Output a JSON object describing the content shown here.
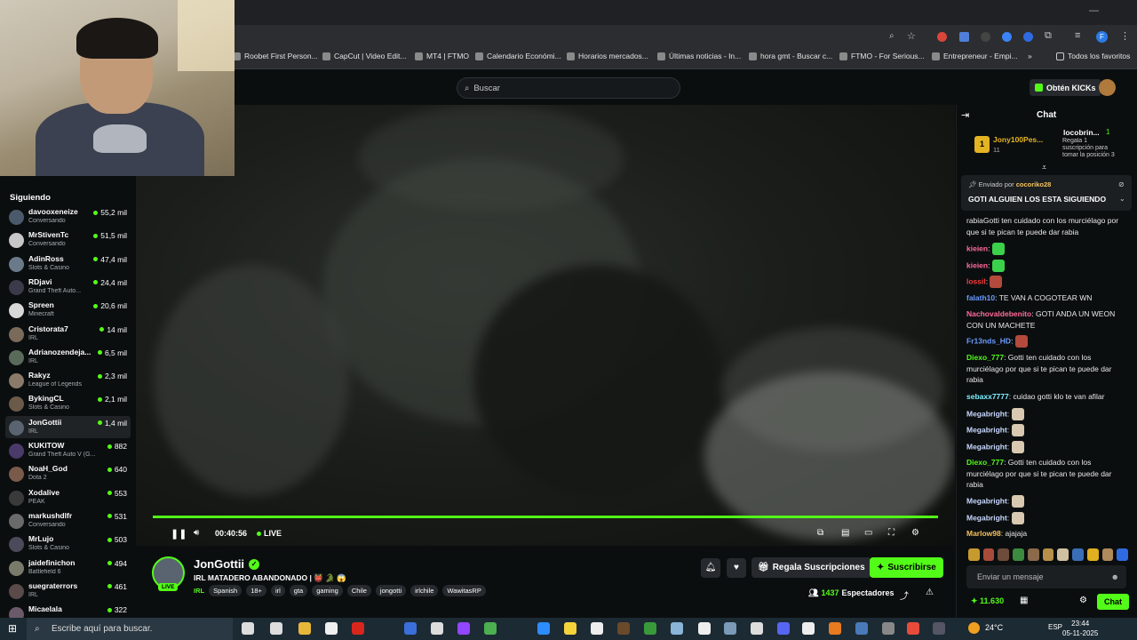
{
  "browser": {
    "bookmarks": [
      {
        "label": "Roobet First Person..."
      },
      {
        "label": "CapCut | Video Edit..."
      },
      {
        "label": "MT4 | FTMO"
      },
      {
        "label": "Calendario Económi..."
      },
      {
        "label": "Horarios mercados..."
      },
      {
        "label": "Últimas noticias - In..."
      },
      {
        "label": "hora gmt - Buscar c..."
      },
      {
        "label": "FTMO - For Serious..."
      },
      {
        "label": "Entrepreneur - Empi..."
      }
    ],
    "more": "»",
    "all_favorites": "Todos los favoritos"
  },
  "header": {
    "search_placeholder": "Buscar",
    "kicks_label": "Obtén KICKs"
  },
  "sidebar": {
    "title": "Siguiendo",
    "channels": [
      {
        "name": "davooxeneize",
        "category": "Conversando",
        "viewers": "55,2 mil"
      },
      {
        "name": "MrStivenTc",
        "category": "Conversando",
        "viewers": "51,5 mil"
      },
      {
        "name": "AdinRoss",
        "category": "Slots & Casino",
        "viewers": "47,4 mil"
      },
      {
        "name": "RDjavi",
        "category": "Grand Theft Auto...",
        "viewers": "24,4 mil"
      },
      {
        "name": "Spreen",
        "category": "Minecraft",
        "viewers": "20,6 mil"
      },
      {
        "name": "Cristorata7",
        "category": "IRL",
        "viewers": "14 mil"
      },
      {
        "name": "Adrianozendeja...",
        "category": "IRL",
        "viewers": "6,5 mil"
      },
      {
        "name": "Rakyz",
        "category": "League of Legends",
        "viewers": "2,3 mil"
      },
      {
        "name": "BykingCL",
        "category": "Slots & Casino",
        "viewers": "2,1 mil"
      },
      {
        "name": "JonGottii",
        "category": "IRL",
        "viewers": "1,4 mil"
      },
      {
        "name": "KUKITOW",
        "category": "Grand Theft Auto V (G...",
        "viewers": "882"
      },
      {
        "name": "NoaH_God",
        "category": "Dota 2",
        "viewers": "640"
      },
      {
        "name": "Xodalive",
        "category": "PEAK",
        "viewers": "553"
      },
      {
        "name": "markushdlfr",
        "category": "Conversando",
        "viewers": "531"
      },
      {
        "name": "MrLujo",
        "category": "Slots & Casino",
        "viewers": "503"
      },
      {
        "name": "jaidefinichon",
        "category": "Battlefield 6",
        "viewers": "494"
      },
      {
        "name": "suegraterrors",
        "category": "IRL",
        "viewers": "461"
      },
      {
        "name": "Micaelala",
        "category": "",
        "viewers": "322"
      }
    ]
  },
  "player": {
    "time": "00:40:56",
    "live": "LIVE",
    "progress": 1.0
  },
  "stream": {
    "name": "JonGottii",
    "live_badge": "LIVE",
    "title": "IRL MATADERO ABANDONADO | 👹 🐊 😱",
    "category": "IRL",
    "tags": [
      "Spanish",
      "18+",
      "irl",
      "gta",
      "gaming",
      "Chile",
      "jongotti",
      "irlchile",
      "WawitasRP"
    ],
    "gift_label": "Regala Suscripciones",
    "subscribe_label": "Suscribirse",
    "viewers": "1437",
    "viewers_label": "Espectadores"
  },
  "chat": {
    "title": "Chat",
    "top_gifter": {
      "name": "Jony100Pes...",
      "count": "11"
    },
    "gift_promo": {
      "name": "locobrin...",
      "count": "1",
      "text": "Regala 1 suscripción para tomar la posición 3"
    },
    "pinned": {
      "sent_by_label": "Enviado por",
      "sender": "cocoriko28",
      "text": "GOTI ALGUIEN LOS ESTA SIGUIENDO"
    },
    "messages": [
      {
        "user": "",
        "text": "rabiaGotti ten cuidado con los murciélago por que si te pican te puede dar rabia",
        "color": "#e8e8e8"
      },
      {
        "user": "kieien",
        "text": "",
        "color": "#ff6b9a",
        "emote": "#3bd14b"
      },
      {
        "user": "kieien",
        "text": "",
        "color": "#ff6b9a",
        "emote": "#3bd14b"
      },
      {
        "user": "lossil",
        "text": "",
        "color": "#ff3b3b",
        "emote": "#b34a3c"
      },
      {
        "user": "falath10",
        "text": "TE VAN A COGOTEAR WN",
        "color": "#6b9cff"
      },
      {
        "user": "Nachovaldebenito",
        "text": "GOTI ANDA UN WEON CON UN MACHETE",
        "color": "#ff6b9a"
      },
      {
        "user": "Fr13nds_HD",
        "text": "",
        "color": "#6b9cff",
        "emote": "#b34a3c"
      },
      {
        "user": "Diexo_777",
        "text": "Gotti ten cuidado con los murciélago por que si te pican te puede dar rabia",
        "color": "#53fc18"
      },
      {
        "user": "sebaxx7777",
        "text": "cuidao gotti klo te van afilar",
        "color": "#7df0ff"
      },
      {
        "user": "Megabright",
        "text": "",
        "color": "#c8d8ff",
        "emote": "#d8c9b0"
      },
      {
        "user": "Megabright",
        "text": "",
        "color": "#c8d8ff",
        "emote": "#d8c9b0"
      },
      {
        "user": "Megabright",
        "text": "",
        "color": "#c8d8ff",
        "emote": "#d8c9b0"
      },
      {
        "user": "Diexo_777",
        "text": "Gotti ten cuidado con los murciélago por que si te pican te puede dar rabia",
        "color": "#53fc18"
      },
      {
        "user": "Megabright",
        "text": "",
        "color": "#c8d8ff",
        "emote": "#d8c9b0"
      },
      {
        "user": "Megabright",
        "text": "",
        "color": "#c8d8ff",
        "emote": "#d8c9b0"
      },
      {
        "user": "Marlow98",
        "text": "ajajaja",
        "color": "#f5c35b"
      }
    ],
    "input_placeholder": "Enviar un mensaje",
    "points": "11.630",
    "send_label": "Chat"
  },
  "taskbar": {
    "search_placeholder": "Escribe aquí para buscar.",
    "weather": "24°C",
    "lang": "ESP",
    "time": "23:44",
    "date": "05-11-2025"
  },
  "colors": {
    "accent": "#53fc18",
    "bg": "#0b0e0f"
  }
}
